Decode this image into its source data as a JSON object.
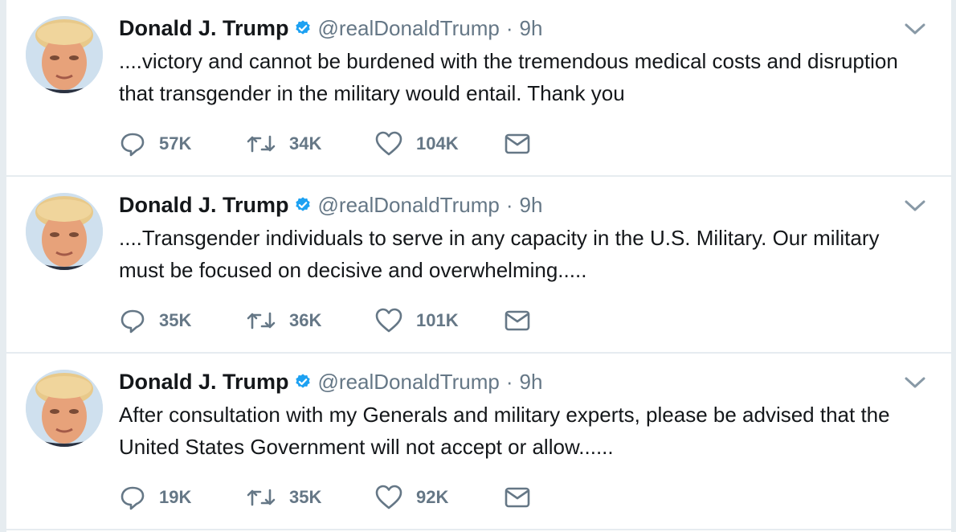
{
  "tweets": [
    {
      "name": "Donald J. Trump",
      "handle": "@realDonaldTrump",
      "separator": "·",
      "time": "9h",
      "text": "....victory and cannot be burdened with the tremendous medical costs and disruption that transgender in the military would entail. Thank you",
      "replies": "57K",
      "retweets": "34K",
      "likes": "104K"
    },
    {
      "name": "Donald J. Trump",
      "handle": "@realDonaldTrump",
      "separator": "·",
      "time": "9h",
      "text": "....Transgender individuals to  serve in any capacity in the U.S. Military. Our military must be focused on decisive and overwhelming.....",
      "replies": "35K",
      "retweets": "36K",
      "likes": "101K"
    },
    {
      "name": "Donald J. Trump",
      "handle": "@realDonaldTrump",
      "separator": "·",
      "time": "9h",
      "text": "After consultation with my Generals and military experts, please be advised that the United States Government will not accept or allow......",
      "replies": "19K",
      "retweets": "35K",
      "likes": "92K"
    }
  ],
  "icons": {
    "reply": "reply-icon",
    "retweet": "retweet-icon",
    "like": "heart-icon",
    "message": "envelope-icon",
    "more": "chevron-down-icon",
    "verified": "verified-badge-icon"
  },
  "colors": {
    "text": "#14171a",
    "secondary": "#657786",
    "verified": "#1da1f2",
    "divider": "#e6ecf0"
  }
}
